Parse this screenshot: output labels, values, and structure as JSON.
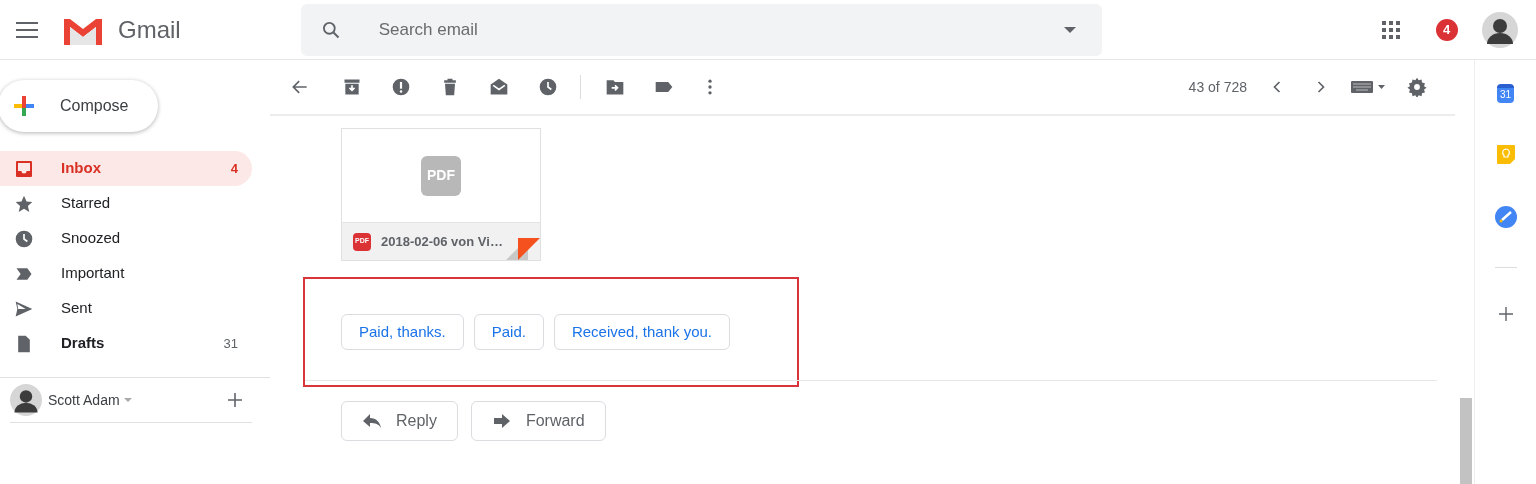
{
  "header": {
    "app_name": "Gmail",
    "search": {
      "placeholder": "Search email"
    },
    "notification_count": "4"
  },
  "sidebar": {
    "compose": "Compose",
    "items": [
      {
        "label": "Inbox",
        "count": "4",
        "selected": true,
        "unread": true
      },
      {
        "label": "Starred",
        "selected": false,
        "unread": false
      },
      {
        "label": "Snoozed",
        "selected": false,
        "unread": false
      },
      {
        "label": "Important",
        "selected": false,
        "unread": false
      },
      {
        "label": "Sent",
        "selected": false,
        "unread": false
      },
      {
        "label": "Drafts",
        "count": "31",
        "selected": false,
        "unread": true
      }
    ],
    "account": "Scott Adam"
  },
  "toolbar": {
    "pagination": "43 of 728"
  },
  "attachment": {
    "file_name": "2018-02-06 von Vi…",
    "type_badge": "PDF",
    "preview_label": "PDF"
  },
  "smart_replies": [
    {
      "label": "Paid, thanks."
    },
    {
      "label": "Paid."
    },
    {
      "label": "Received, thank you."
    }
  ],
  "actions": [
    {
      "label": "Reply"
    },
    {
      "label": "Forward"
    }
  ],
  "side_rail": {
    "calendar_day": "31"
  }
}
